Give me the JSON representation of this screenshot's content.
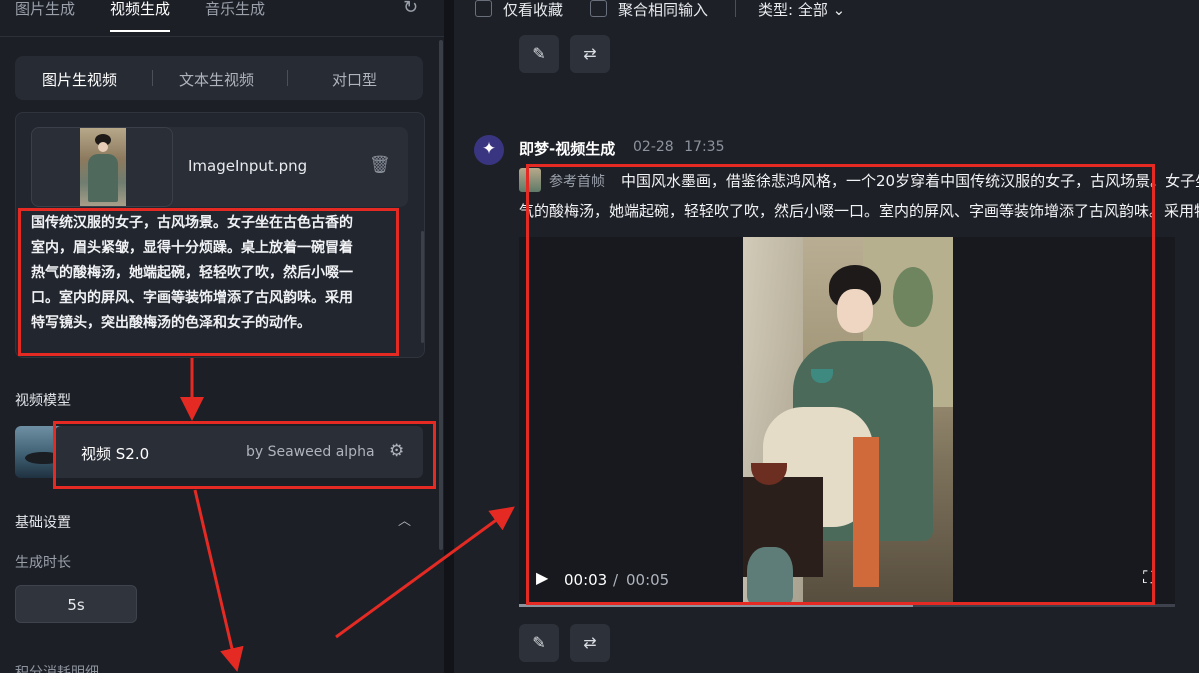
{
  "left_panel": {
    "top_tabs": [
      {
        "label": "图片生成"
      },
      {
        "label": "视频生成",
        "active": true
      },
      {
        "label": "音乐生成"
      }
    ],
    "refresh_icon": "refresh-icon",
    "sub_tabs": [
      {
        "label": "图片生视频",
        "active": true
      },
      {
        "label": "文本生视频"
      },
      {
        "label": "对口型"
      }
    ],
    "image_input": {
      "filename": "ImageInput.png",
      "delete_icon": "trash-icon"
    },
    "prompt_lines": [
      "国传统汉服的女子，古风场景。女子坐在古色古香的",
      "室内，眉头紧皱，显得十分烦躁。桌上放着一碗冒着",
      "热气的酸梅汤，她端起碗，轻轻吹了吹，然后小啜一",
      "口。室内的屏风、字画等装饰增添了古风韵味。采用",
      "特写镜头，突出酸梅汤的色泽和女子的动作。"
    ],
    "model_section": {
      "label": "视频模型",
      "model_name": "视频 S2.0",
      "model_by": "by Seaweed alpha",
      "settings_icon": "sliders-icon"
    },
    "basic_settings": {
      "label": "基础设置",
      "collapse_icon": "chevron-up-icon",
      "duration_label": "生成时长",
      "duration_value": "5s"
    },
    "cut_off_label": "积分消耗明细"
  },
  "right_panel": {
    "filters": {
      "favorites_only": "仅看收藏",
      "merge_same_input": "聚合相同输入",
      "type_filter": "类型: 全部"
    },
    "message": {
      "title": "即梦-视频生成",
      "date": "02-28",
      "time": "17:35",
      "ref_label": "参考首帧",
      "prompt_line1": "中国风水墨画，借鉴徐悲鸿风格，一个20岁穿着中国传统汉服的女子，古风场景。女子坐在古色古香的室内",
      "prompt_line2": "气的酸梅汤，她端起碗，轻轻吹了吹，然后小啜一口。室内的屏风、字画等装饰增添了古风韵味。采用特写镜头"
    },
    "video": {
      "current_time": "00:03",
      "separator": "/",
      "total_time": "00:05",
      "progress": 0.6
    },
    "action_icons": [
      "edit-icon",
      "regenerate-icon"
    ]
  },
  "colors": {
    "annotation_red": "#e52a24",
    "background": "#1b1e25",
    "panel": "#2a2e37"
  }
}
